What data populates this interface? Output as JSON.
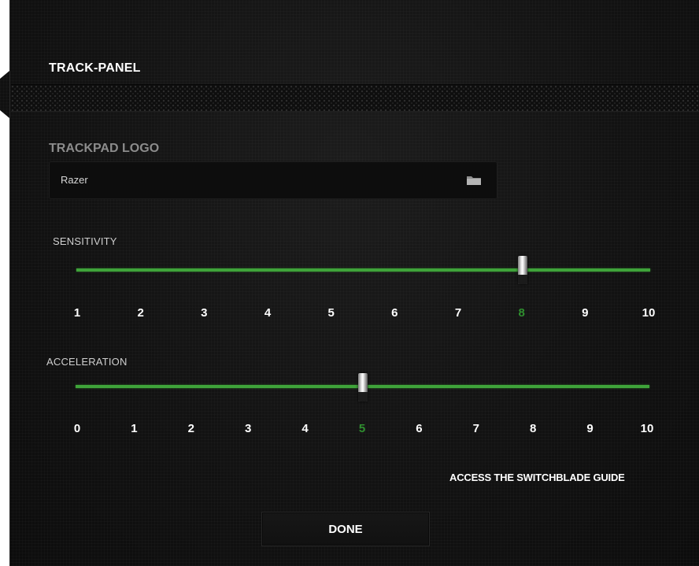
{
  "window": {
    "title": "TRACK-PANEL"
  },
  "trackpad_logo": {
    "label": "TRACKPAD LOGO",
    "value": "Razer",
    "icon": "folder-icon"
  },
  "sensitivity": {
    "label": "SENSITIVITY",
    "min": 1,
    "max": 10,
    "value": 8,
    "ticks": [
      "1",
      "2",
      "3",
      "4",
      "5",
      "6",
      "7",
      "8",
      "9",
      "10"
    ]
  },
  "acceleration": {
    "label": "ACCELERATION",
    "min": 0,
    "max": 10,
    "value": 5,
    "ticks": [
      "0",
      "1",
      "2",
      "3",
      "4",
      "5",
      "6",
      "7",
      "8",
      "9",
      "10"
    ]
  },
  "guide_link": "ACCESS THE SWITCHBLADE GUIDE",
  "done_label": "DONE",
  "colors": {
    "accent": "#3fa33a",
    "active_tick": "#2f8f2f",
    "background": "#141414"
  }
}
